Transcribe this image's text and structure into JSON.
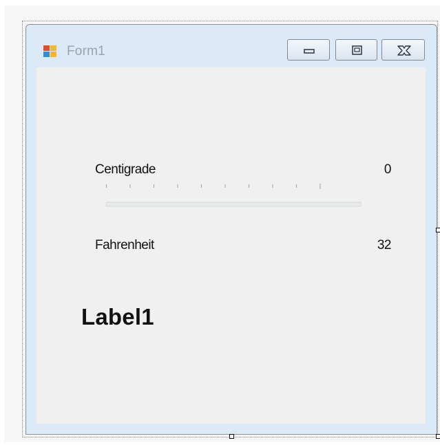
{
  "window": {
    "title": "Form1"
  },
  "caption_buttons": [
    "minimize",
    "maximize",
    "close"
  ],
  "centigrade": {
    "label": "Centigrade",
    "value": "0"
  },
  "fahrenheit": {
    "label": "Fahrenheit",
    "value": "32"
  },
  "trackbar": {
    "value": 0,
    "minimum": 0,
    "tick_count": 11,
    "accent_color": "#0078d7"
  },
  "label1": {
    "text": "Label1"
  },
  "icons": {
    "app": "form-icon",
    "minimize": "minimize-icon",
    "maximize": "maximize-icon",
    "close": "close-icon"
  },
  "colors": {
    "client_background": "#f0f0f0",
    "window_frame": "#dce9f6",
    "title_text": "#9aa3ad"
  }
}
